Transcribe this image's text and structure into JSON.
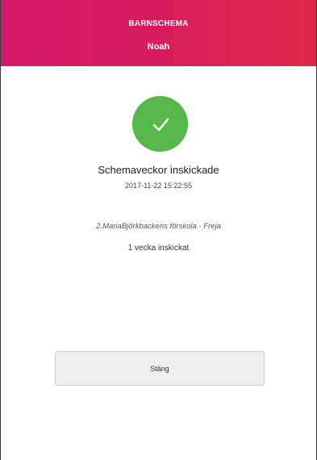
{
  "header": {
    "title": "BARNSCHEMA",
    "child_name": "Noah",
    "color": "#d81f5c"
  },
  "status": {
    "icon": "check-icon",
    "icon_color": "#54b948",
    "title": "Schemaveckor inskickade",
    "timestamp": "2017-11-22 15:22:55"
  },
  "submission": {
    "school": "2.MariaBjörkbackens förskola - Freja",
    "weeks_sent": "1 vecka inskickat"
  },
  "actions": {
    "close_label": "Stäng"
  }
}
